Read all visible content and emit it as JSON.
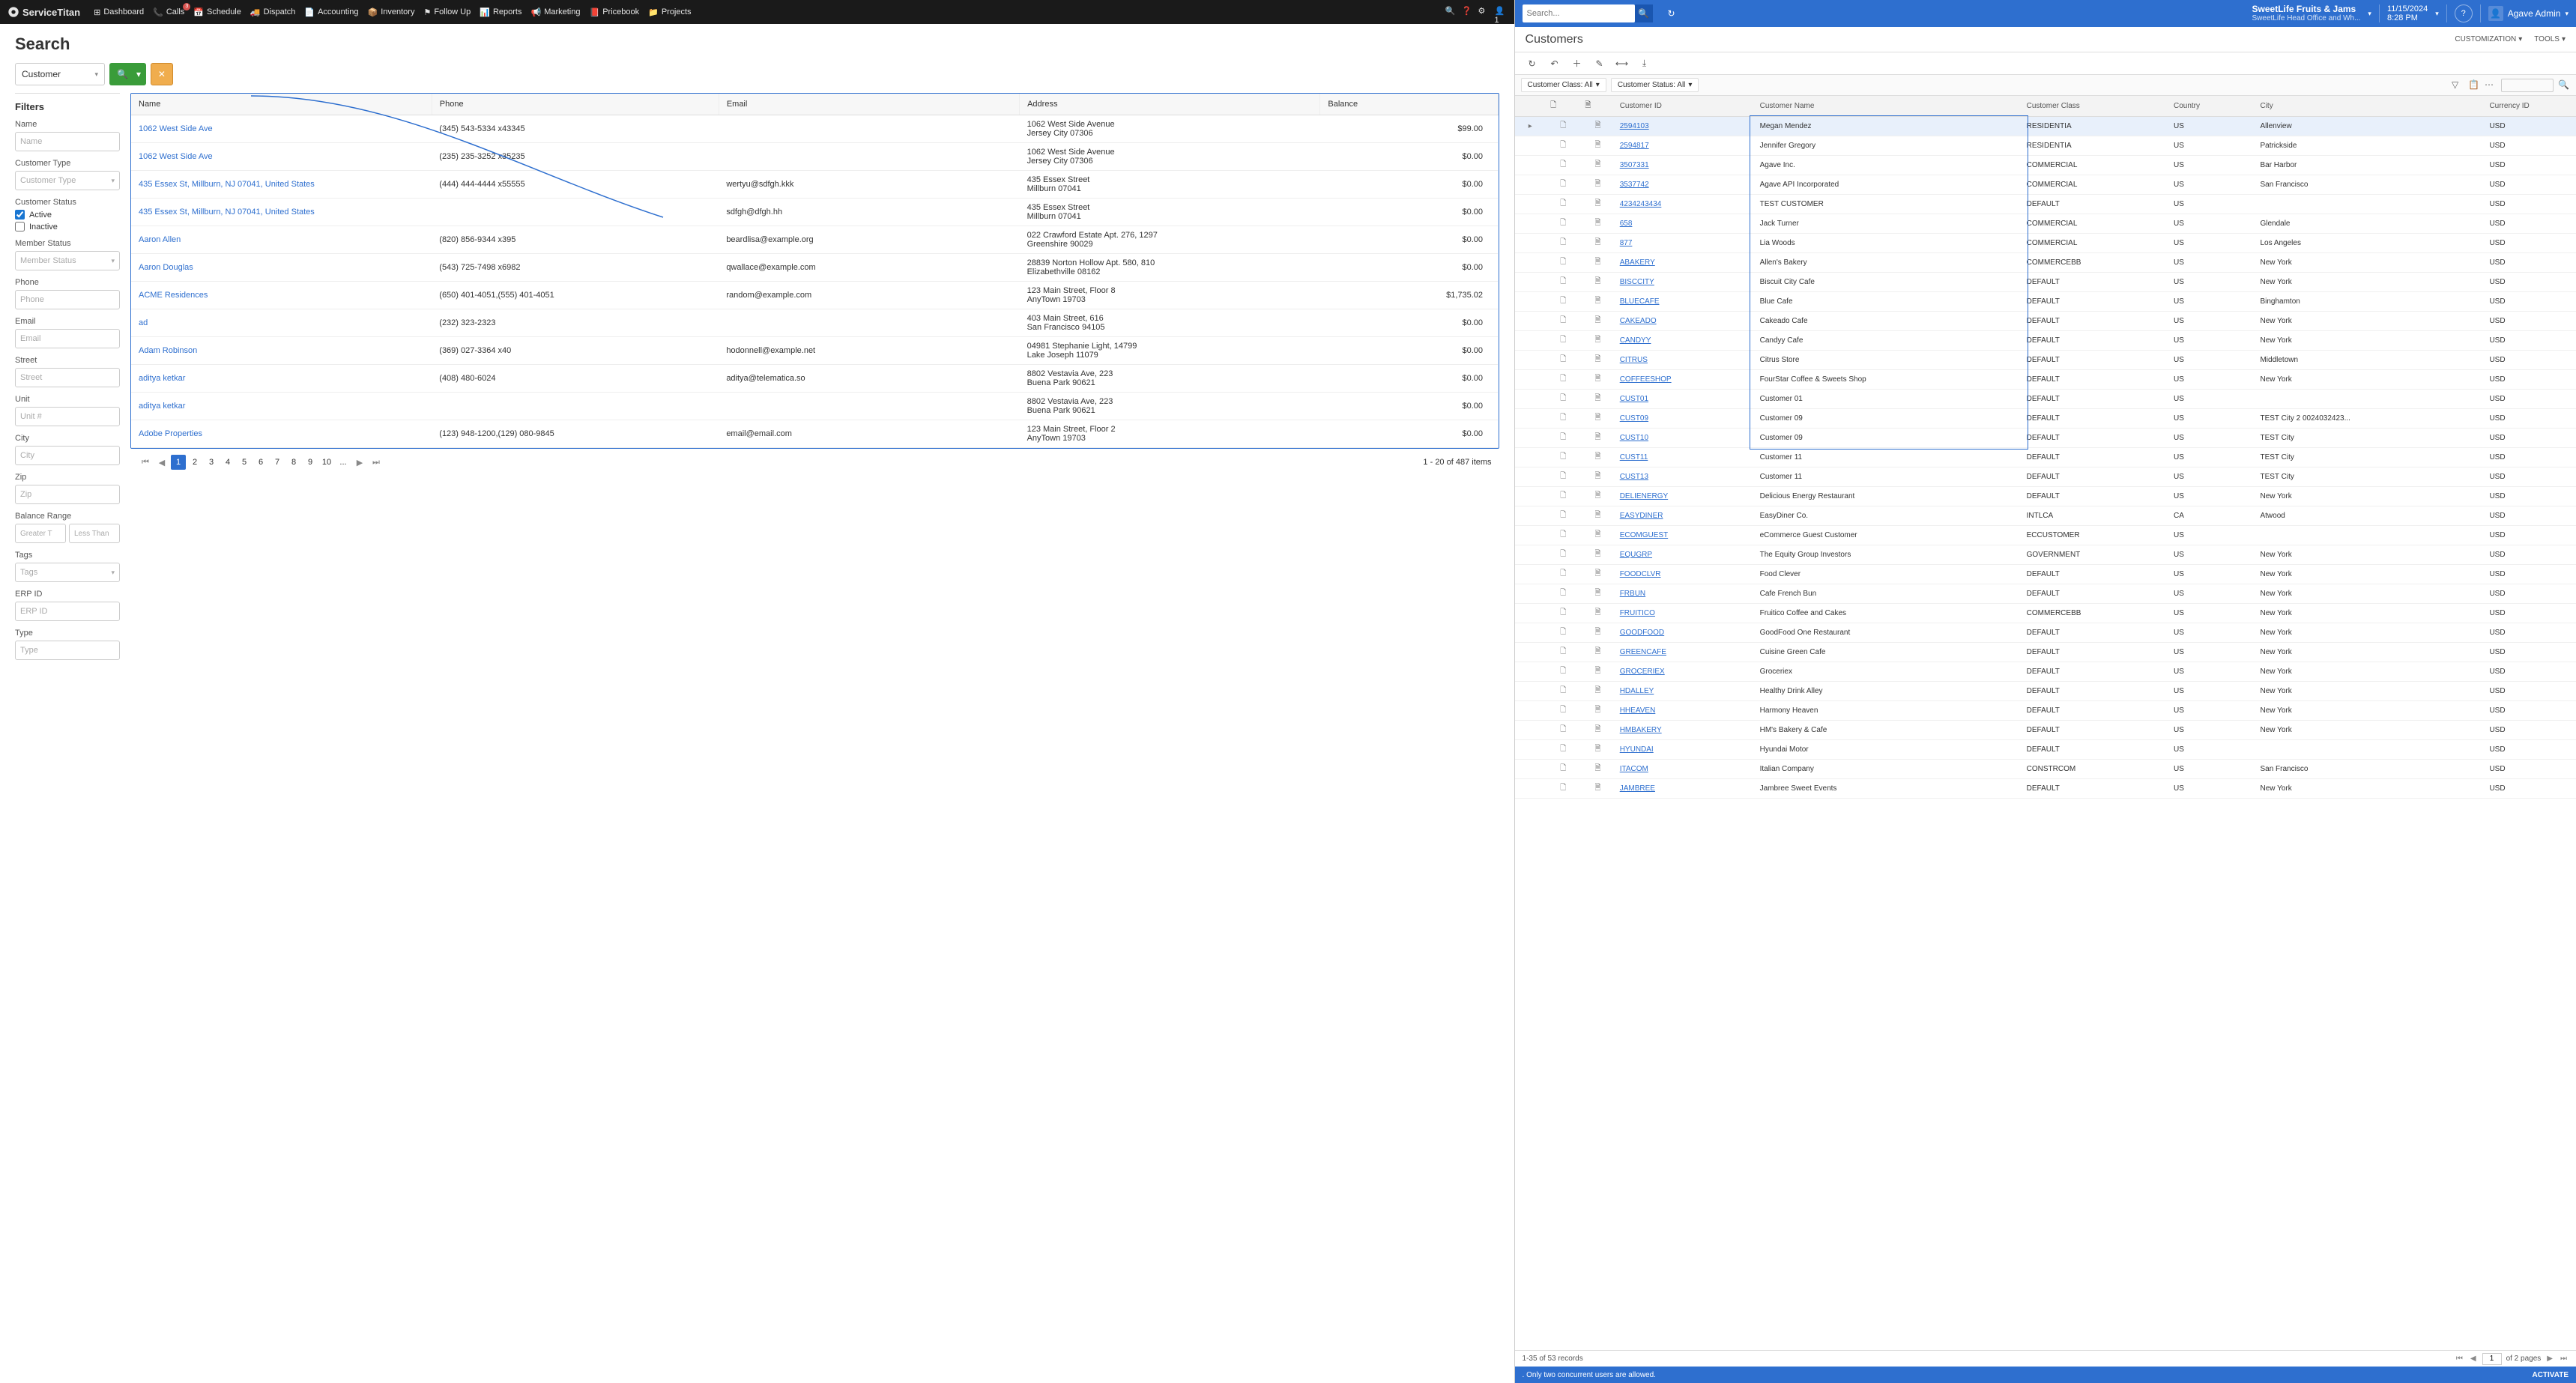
{
  "left": {
    "logo": "ServiceTitan",
    "nav": [
      {
        "icon": "dashboard",
        "label": "Dashboard"
      },
      {
        "icon": "phone",
        "label": "Calls",
        "badge": "3"
      },
      {
        "icon": "calendar",
        "label": "Schedule"
      },
      {
        "icon": "truck",
        "label": "Dispatch"
      },
      {
        "icon": "doc",
        "label": "Accounting"
      },
      {
        "icon": "box",
        "label": "Inventory"
      },
      {
        "icon": "flag",
        "label": "Follow Up"
      },
      {
        "icon": "chart",
        "label": "Reports"
      },
      {
        "icon": "megaphone",
        "label": "Marketing"
      },
      {
        "icon": "book",
        "label": "Pricebook"
      },
      {
        "icon": "folder",
        "label": "Projects"
      }
    ],
    "title": "Search",
    "searchType": "Customer",
    "filtersTitle": "Filters",
    "filters": {
      "name": {
        "label": "Name",
        "ph": "Name"
      },
      "customerType": {
        "label": "Customer Type",
        "ph": "Customer Type"
      },
      "customerStatus": {
        "label": "Customer Status",
        "active": "Active",
        "inactive": "Inactive"
      },
      "memberStatus": {
        "label": "Member Status",
        "ph": "Member Status"
      },
      "phone": {
        "label": "Phone",
        "ph": "Phone"
      },
      "email": {
        "label": "Email",
        "ph": "Email"
      },
      "street": {
        "label": "Street",
        "ph": "Street"
      },
      "unit": {
        "label": "Unit",
        "ph": "Unit #"
      },
      "city": {
        "label": "City",
        "ph": "City"
      },
      "zip": {
        "label": "Zip",
        "ph": "Zip"
      },
      "balance": {
        "label": "Balance Range",
        "gt": "Greater T",
        "lt": "Less Than"
      },
      "tags": {
        "label": "Tags",
        "ph": "Tags"
      },
      "erpId": {
        "label": "ERP ID",
        "ph": "ERP ID"
      },
      "type": {
        "label": "Type",
        "ph": "Type"
      }
    },
    "columns": [
      "Name",
      "Phone",
      "Email",
      "Address",
      "Balance"
    ],
    "rows": [
      {
        "name": "1062 West Side Ave",
        "phone": "(345) 543-5334 x43345",
        "email": "",
        "addr": "1062 West Side Avenue\nJersey City 07306",
        "bal": "$99.00"
      },
      {
        "name": "1062 West Side Ave",
        "phone": "(235) 235-3252 x35235",
        "email": "",
        "addr": "1062 West Side Avenue\nJersey City 07306",
        "bal": "$0.00"
      },
      {
        "name": "435 Essex St, Millburn, NJ 07041, United States",
        "phone": "(444) 444-4444 x55555",
        "email": "wertyu@sdfgh.kkk",
        "addr": "435 Essex Street\nMillburn 07041",
        "bal": "$0.00"
      },
      {
        "name": "435 Essex St, Millburn, NJ 07041, United States",
        "phone": "",
        "email": "sdfgh@dfgh.hh",
        "addr": "435 Essex Street\nMillburn 07041",
        "bal": "$0.00"
      },
      {
        "name": "Aaron Allen",
        "phone": "(820) 856-9344 x395",
        "email": "beardlisa@example.org",
        "addr": "022 Crawford Estate Apt. 276, 1297\nGreenshire 90029",
        "bal": "$0.00"
      },
      {
        "name": "Aaron Douglas",
        "phone": "(543) 725-7498 x6982",
        "email": "qwallace@example.com",
        "addr": "28839 Norton Hollow Apt. 580, 810\nElizabethville 08162",
        "bal": "$0.00"
      },
      {
        "name": "ACME Residences",
        "phone": "(650) 401-4051,(555) 401-4051",
        "email": "random@example.com",
        "addr": "123 Main Street, Floor 8\nAnyTown 19703",
        "bal": "$1,735.02"
      },
      {
        "name": "ad",
        "phone": "(232) 323-2323",
        "email": "",
        "addr": "403 Main Street, 616\nSan Francisco 94105",
        "bal": "$0.00"
      },
      {
        "name": "Adam Robinson",
        "phone": "(369) 027-3364 x40",
        "email": "hodonnell@example.net",
        "addr": "04981 Stephanie Light, 14799\nLake Joseph 11079",
        "bal": "$0.00"
      },
      {
        "name": "aditya ketkar",
        "phone": "(408) 480-6024",
        "email": "aditya@telematica.so",
        "addr": "8802 Vestavia Ave, 223\nBuena Park 90621",
        "bal": "$0.00"
      },
      {
        "name": "aditya ketkar",
        "phone": "",
        "email": "",
        "addr": "8802 Vestavia Ave, 223\nBuena Park 90621",
        "bal": "$0.00"
      },
      {
        "name": "Adobe Properties",
        "phone": "(123) 948-1200,(129) 080-9845",
        "email": "email@email.com",
        "addr": "123 Main Street, Floor 2\nAnyTown 19703",
        "bal": "$0.00"
      }
    ],
    "pages": [
      "1",
      "2",
      "3",
      "4",
      "5",
      "6",
      "7",
      "8",
      "9",
      "10",
      "..."
    ],
    "pageInfo": "1 - 20 of 487 items"
  },
  "right": {
    "search_ph": "Search...",
    "company": "SweetLife Fruits & Jams",
    "companySub": "SweetLife Head Office and Wh...",
    "date": "11/15/2024",
    "time": "8:28 PM",
    "user": "Agave Admin",
    "subtitle": "Customers",
    "customization": "CUSTOMIZATION",
    "tools": "TOOLS",
    "filter1": "Customer Class: All",
    "filter2": "Customer Status: All",
    "columns": [
      "Customer ID",
      "Customer Name",
      "Customer Class",
      "Country",
      "City",
      "Currency ID"
    ],
    "rows": [
      {
        "id": "2594103",
        "name": "Megan Mendez",
        "cls": "RESIDENTIA",
        "co": "US",
        "city": "Allenview",
        "cur": "USD",
        "sel": true
      },
      {
        "id": "2594817",
        "name": "Jennifer Gregory",
        "cls": "RESIDENTIA",
        "co": "US",
        "city": "Patrickside",
        "cur": "USD"
      },
      {
        "id": "3507331",
        "name": "Agave Inc.",
        "cls": "COMMERCIAL",
        "co": "US",
        "city": "Bar Harbor",
        "cur": "USD"
      },
      {
        "id": "3537742",
        "name": "Agave API Incorporated",
        "cls": "COMMERCIAL",
        "co": "US",
        "city": "San Francisco",
        "cur": "USD"
      },
      {
        "id": "4234243434",
        "name": "TEST CUSTOMER",
        "cls": "DEFAULT",
        "co": "US",
        "city": "",
        "cur": "USD"
      },
      {
        "id": "658",
        "name": "Jack Turner",
        "cls": "COMMERCIAL",
        "co": "US",
        "city": "Glendale",
        "cur": "USD"
      },
      {
        "id": "877",
        "name": "Lia Woods",
        "cls": "COMMERCIAL",
        "co": "US",
        "city": "Los Angeles",
        "cur": "USD"
      },
      {
        "id": "ABAKERY",
        "name": "Allen's Bakery",
        "cls": "COMMERCEBB",
        "co": "US",
        "city": "New York",
        "cur": "USD"
      },
      {
        "id": "BISCCITY",
        "name": "Biscuit City Cafe",
        "cls": "DEFAULT",
        "co": "US",
        "city": "New York",
        "cur": "USD"
      },
      {
        "id": "BLUECAFE",
        "name": "Blue Cafe",
        "cls": "DEFAULT",
        "co": "US",
        "city": "Binghamton",
        "cur": "USD"
      },
      {
        "id": "CAKEADO",
        "name": "Cakeado Cafe",
        "cls": "DEFAULT",
        "co": "US",
        "city": "New York",
        "cur": "USD"
      },
      {
        "id": "CANDYY",
        "name": "Candyy Cafe",
        "cls": "DEFAULT",
        "co": "US",
        "city": "New York",
        "cur": "USD"
      },
      {
        "id": "CITRUS",
        "name": "Citrus Store",
        "cls": "DEFAULT",
        "co": "US",
        "city": "Middletown",
        "cur": "USD"
      },
      {
        "id": "COFFEESHOP",
        "name": "FourStar Coffee & Sweets Shop",
        "cls": "DEFAULT",
        "co": "US",
        "city": "New York",
        "cur": "USD"
      },
      {
        "id": "CUST01",
        "name": "Customer 01",
        "cls": "DEFAULT",
        "co": "US",
        "city": "",
        "cur": "USD"
      },
      {
        "id": "CUST09",
        "name": "Customer 09",
        "cls": "DEFAULT",
        "co": "US",
        "city": "TEST City 2 0024032423...",
        "cur": "USD"
      },
      {
        "id": "CUST10",
        "name": "Customer 09",
        "cls": "DEFAULT",
        "co": "US",
        "city": "TEST City",
        "cur": "USD"
      },
      {
        "id": "CUST11",
        "name": "Customer 11",
        "cls": "DEFAULT",
        "co": "US",
        "city": "TEST City",
        "cur": "USD"
      },
      {
        "id": "CUST13",
        "name": "Customer 11",
        "cls": "DEFAULT",
        "co": "US",
        "city": "TEST City",
        "cur": "USD"
      },
      {
        "id": "DELIENERGY",
        "name": "Delicious Energy Restaurant",
        "cls": "DEFAULT",
        "co": "US",
        "city": "New York",
        "cur": "USD"
      },
      {
        "id": "EASYDINER",
        "name": "EasyDiner Co.",
        "cls": "INTLCA",
        "co": "CA",
        "city": "Atwood",
        "cur": "USD"
      },
      {
        "id": "ECOMGUEST",
        "name": "eCommerce Guest Customer",
        "cls": "ECCUSTOMER",
        "co": "US",
        "city": "",
        "cur": "USD"
      },
      {
        "id": "EQUGRP",
        "name": "The Equity Group Investors",
        "cls": "GOVERNMENT",
        "co": "US",
        "city": "New York",
        "cur": "USD"
      },
      {
        "id": "FOODCLVR",
        "name": "Food Clever",
        "cls": "DEFAULT",
        "co": "US",
        "city": "New York",
        "cur": "USD"
      },
      {
        "id": "FRBUN",
        "name": "Cafe French Bun",
        "cls": "DEFAULT",
        "co": "US",
        "city": "New York",
        "cur": "USD"
      },
      {
        "id": "FRUITICO",
        "name": "Fruitico Coffee and Cakes",
        "cls": "COMMERCEBB",
        "co": "US",
        "city": "New York",
        "cur": "USD"
      },
      {
        "id": "GOODFOOD",
        "name": "GoodFood One Restaurant",
        "cls": "DEFAULT",
        "co": "US",
        "city": "New York",
        "cur": "USD"
      },
      {
        "id": "GREENCAFE",
        "name": "Cuisine Green Cafe",
        "cls": "DEFAULT",
        "co": "US",
        "city": "New York",
        "cur": "USD"
      },
      {
        "id": "GROCERIEX",
        "name": "Groceriex",
        "cls": "DEFAULT",
        "co": "US",
        "city": "New York",
        "cur": "USD"
      },
      {
        "id": "HDALLEY",
        "name": "Healthy Drink Alley",
        "cls": "DEFAULT",
        "co": "US",
        "city": "New York",
        "cur": "USD"
      },
      {
        "id": "HHEAVEN",
        "name": "Harmony Heaven",
        "cls": "DEFAULT",
        "co": "US",
        "city": "New York",
        "cur": "USD"
      },
      {
        "id": "HMBAKERY",
        "name": "HM's Bakery & Cafe",
        "cls": "DEFAULT",
        "co": "US",
        "city": "New York",
        "cur": "USD"
      },
      {
        "id": "HYUNDAI",
        "name": "Hyundai Motor",
        "cls": "DEFAULT",
        "co": "US",
        "city": "",
        "cur": "USD"
      },
      {
        "id": "ITACOM",
        "name": "Italian Company",
        "cls": "CONSTRCOM",
        "co": "US",
        "city": "San Francisco",
        "cur": "USD"
      },
      {
        "id": "JAMBREE",
        "name": "Jambree Sweet Events",
        "cls": "DEFAULT",
        "co": "US",
        "city": "New York",
        "cur": "USD"
      }
    ],
    "recordCount": "1-35 of 53 records",
    "pageNum": "1",
    "pageTotal": "of 2 pages",
    "warning": ". Only two concurrent users are allowed.",
    "activate": "ACTIVATE"
  }
}
